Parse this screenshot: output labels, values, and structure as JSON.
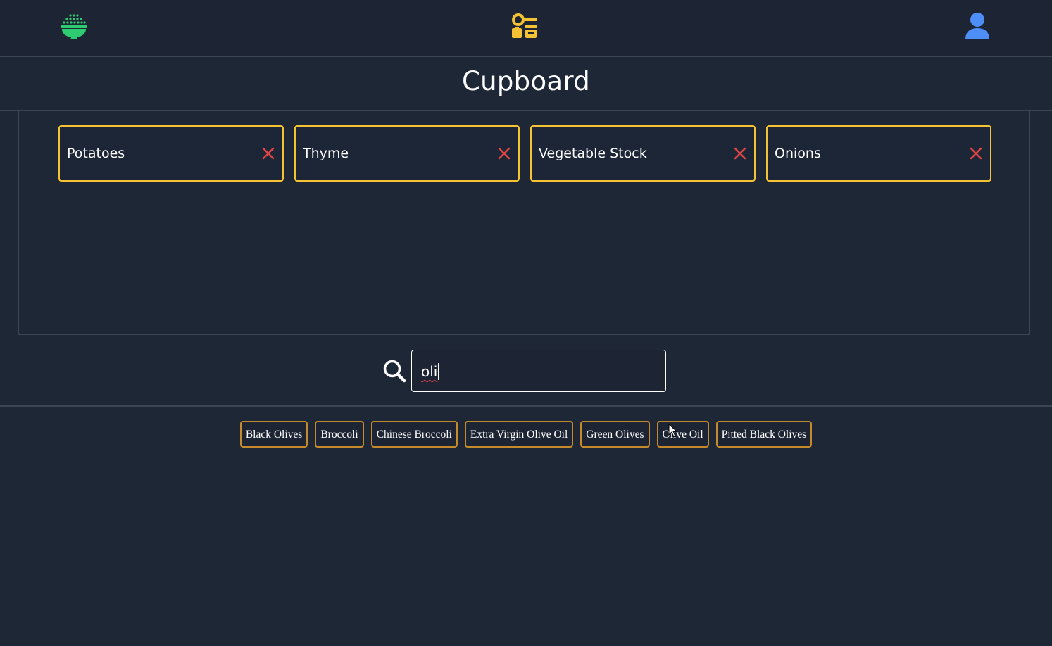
{
  "header": {
    "left_icon": "rice-bowl-icon",
    "center_icon": "cupboard-icon",
    "right_icon": "user-icon",
    "accent_green": "#2ecc71",
    "accent_yellow": "#f5c233",
    "accent_blue": "#4e8ef7"
  },
  "page": {
    "title": "Cupboard"
  },
  "cupboard": {
    "items": [
      {
        "label": "Potatoes",
        "remove_icon": "close-icon"
      },
      {
        "label": "Thyme",
        "remove_icon": "close-icon"
      },
      {
        "label": "Vegetable Stock",
        "remove_icon": "close-icon"
      },
      {
        "label": "Onions",
        "remove_icon": "close-icon"
      }
    ],
    "card_border_color": "#f5c233",
    "remove_color": "#e04545"
  },
  "search": {
    "icon": "search-icon",
    "value": "oli",
    "placeholder": ""
  },
  "suggestions": {
    "items": [
      "Black Olives",
      "Broccoli",
      "Chinese Broccoli",
      "Extra Virgin Olive Oil",
      "Green Olives",
      "Olive Oil",
      "Pitted Black Olives"
    ],
    "border_color": "#c58a2c"
  }
}
